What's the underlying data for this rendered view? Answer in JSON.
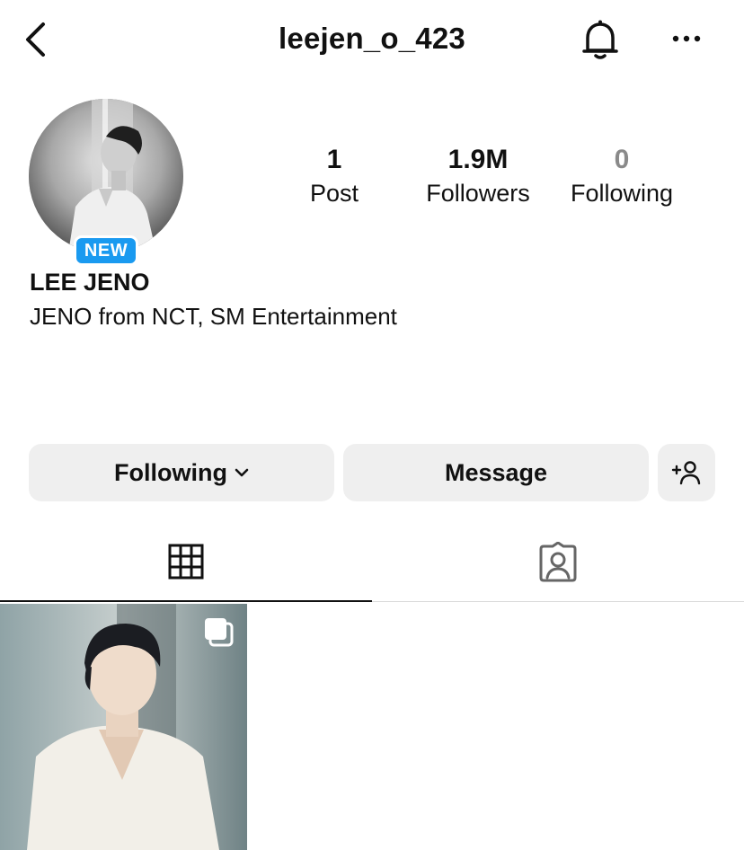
{
  "header": {
    "username": "leejen_o_423",
    "back_icon": "chevron-left-icon",
    "bell_icon": "bell-icon",
    "more_icon": "more-horizontal-icon"
  },
  "profile": {
    "badge": "NEW",
    "display_name": "LEE JENO",
    "bio": "JENO from NCT, SM Entertainment",
    "avatar_description_icon": "profile-photo"
  },
  "stats": {
    "posts": {
      "value": "1",
      "label": "Post"
    },
    "followers": {
      "value": "1.9M",
      "label": "Followers"
    },
    "following": {
      "value": "0",
      "label": "Following"
    }
  },
  "actions": {
    "following_label": "Following",
    "message_label": "Message",
    "add_user_icon": "add-user-icon"
  },
  "tabs": [
    {
      "name": "grid",
      "icon": "grid-icon",
      "active": true
    },
    {
      "name": "tagged",
      "icon": "tagged-person-icon",
      "active": false
    }
  ],
  "posts": [
    {
      "type": "carousel",
      "icon": "multiple-images-icon"
    }
  ],
  "colors": {
    "badge_blue": "#1a9af0",
    "button_bg": "#efefef",
    "muted_text": "#8a8a8a"
  }
}
